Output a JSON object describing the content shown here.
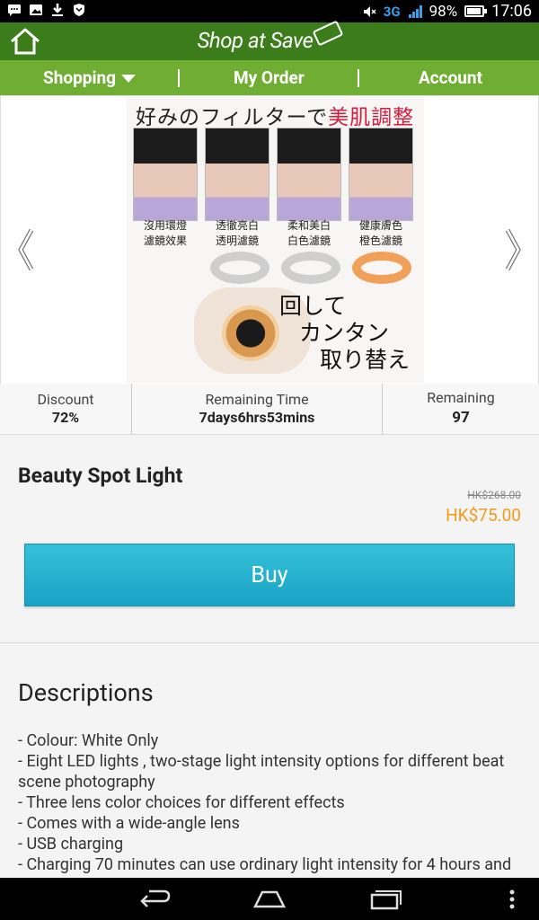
{
  "status_bar": {
    "network": "3G",
    "battery_percent": "98%",
    "time": "17:06",
    "left_icons": [
      "chat-icon",
      "image-icon",
      "download-icon",
      "shield-icon"
    ],
    "right_icons": [
      "mute-icon",
      "signal-icon",
      "battery-icon"
    ]
  },
  "header": {
    "logo_text": "Shop at Save",
    "home_icon": "home-icon"
  },
  "nav": {
    "items": [
      {
        "label": "Shopping",
        "has_dropdown": true
      },
      {
        "label": "My Order"
      },
      {
        "label": "Account"
      }
    ]
  },
  "hero": {
    "image_title_prefix": "好みのフィルターで",
    "image_title_highlight": "美肌調整",
    "captions": [
      [
        "沒用環燈",
        "濾鏡效果"
      ],
      [
        "透徹亮白",
        "透明濾鏡"
      ],
      [
        "柔和美白",
        "白色濾鏡"
      ],
      [
        "健康膚色",
        "橙色濾鏡"
      ]
    ],
    "promo_text_lines": [
      "回して",
      "カンタン",
      "取り替え"
    ],
    "prev_icon": "chevron-left-icon",
    "next_icon": "chevron-right-icon"
  },
  "stats": {
    "discount": {
      "label": "Discount",
      "value": "72%"
    },
    "remaining_time": {
      "label": "Remaining Time",
      "value": "7days6hrs53mins"
    },
    "remaining": {
      "label": "Remaining",
      "value": "97"
    }
  },
  "product": {
    "name": "Beauty Spot Light",
    "original_price": "HK$268.00",
    "sale_price": "HK$75.00",
    "buy_label": "Buy"
  },
  "descriptions": {
    "heading": "Descriptions",
    "items": [
      "- Colour: White Only",
      "- Eight LED lights , two-stage light intensity options for different beat scene photography",
      "- Three lens color choices for different effects",
      "- Comes with a wide-angle lens",
      "- USB charging",
      "- Charging 70 minutes can use ordinary light intensity for 4 hours and"
    ]
  },
  "android_nav": {
    "buttons": [
      "back-icon",
      "home-icon",
      "recent-apps-icon",
      "menu-icon"
    ]
  },
  "colors": {
    "header_green": "#3a7d1a",
    "nav_green": "#6fae32",
    "buy_blue": "#1aa3c6",
    "price_orange": "#f39a1c"
  }
}
